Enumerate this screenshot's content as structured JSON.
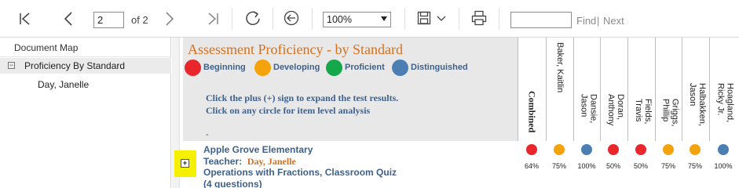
{
  "toolbar": {
    "page_value": "2",
    "page_of": "of 2",
    "zoom_value": "100%",
    "find_label": "Find",
    "find_separator": "|",
    "next_label": "Next"
  },
  "docmap": {
    "title": "Document Map",
    "node_label": "Proficiency By Standard",
    "node_toggle": "⊟",
    "child_label": "Day, Janelle"
  },
  "report": {
    "title": "Assessment Proficiency - by Standard",
    "legend": [
      {
        "label": "Beginning",
        "color": "#e8262c"
      },
      {
        "label": "Developing",
        "color": "#f5a30c"
      },
      {
        "label": "Proficient",
        "color": "#14a84a"
      },
      {
        "label": "Distinguished",
        "color": "#4b7fb3"
      }
    ],
    "instruction_1": "Click the plus (+) sign to expand the test results.",
    "instruction_2": "Click on any circle for item level analysis",
    "dash": "-",
    "columns": [
      {
        "label": "Combined",
        "bold": true
      },
      {
        "label": "Baker, Kaitlin"
      },
      {
        "label": "Dansie, Jason"
      },
      {
        "label": "Doran, Anthony"
      },
      {
        "label": "Fields, Travis"
      },
      {
        "label": "Griggs, Phillip"
      },
      {
        "label": "Halbakken, Jason"
      },
      {
        "label": "Hoagland, Ricky Jr."
      }
    ],
    "row": {
      "school": "Apple Grove Elementary",
      "teacher_label": "Teacher:",
      "teacher_name": "Day, Janelle",
      "assessment": "Operations with Fractions, Classroom Quiz",
      "questions": "(4 questions)",
      "expand_glyph": "+",
      "results": [
        {
          "pct": "64%",
          "color": "#e8262c"
        },
        {
          "pct": "75%",
          "color": "#f5a30c"
        },
        {
          "pct": "100%",
          "color": "#4b7fb3"
        },
        {
          "pct": "50%",
          "color": "#e8262c"
        },
        {
          "pct": "50%",
          "color": "#e8262c"
        },
        {
          "pct": "75%",
          "color": "#f5a30c"
        },
        {
          "pct": "75%",
          "color": "#f5a30c"
        },
        {
          "pct": "100%",
          "color": "#4b7fb3"
        }
      ]
    }
  }
}
